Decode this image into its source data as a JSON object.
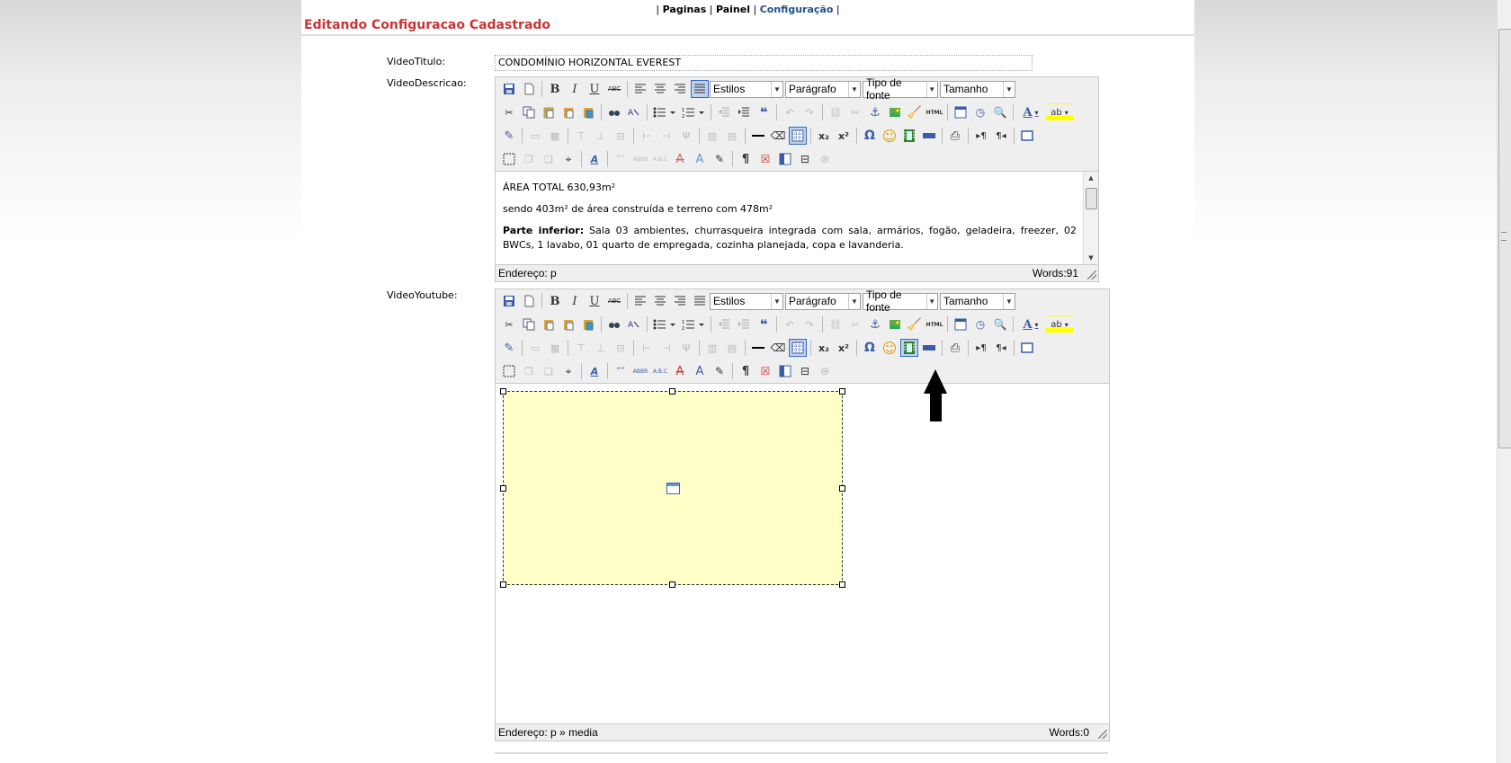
{
  "nav": {
    "pre": "| ",
    "links": [
      "Paginas",
      "Painel",
      "Configuração"
    ],
    "sep": " | ",
    "post": " |"
  },
  "page_title": "Editando Configuracao Cadastrado",
  "fields": {
    "titulo_label": "VideoTitulo:",
    "titulo_value": "CONDOMÍNIO HORIZONTAL EVEREST",
    "descricao_label": "VideoDescricao:",
    "youtube_label": "VideoYoutube:"
  },
  "toolbar": {
    "styles": "Estilos",
    "format": "Parágrafo",
    "font": "Tipo de fonte",
    "size": "Tamanho",
    "bold": "B",
    "italic": "I",
    "underline": "U",
    "strike": "ABC",
    "html": "HTML",
    "sub": "x₂",
    "sup": "x²",
    "omega": "Ω",
    "smile": "☺",
    "quote": "❝",
    "pilcrow": "¶"
  },
  "descricao": {
    "line1": "ÁREA TOTAL 630,93m²",
    "line2": "sendo 403m² de área construída e terreno com 478m²",
    "line3_bold": "Parte inferior:",
    "line3": " Sala 03 ambientes, churrasqueira integrada com sala, armários, fogão, geladeira, freezer, 02 BWCs, 1 lavabo, 01 quarto de empregada, cozinha planejada, copa e lavanderia.",
    "status_path_label": "Endereço: ",
    "status_path": "p",
    "words": "Words:91"
  },
  "youtube": {
    "status_path_label": "Endereço: ",
    "status_path": "p » media",
    "words": "Words:0"
  },
  "colors": {
    "title": "#cc3333",
    "active_link": "#1f4e8c",
    "media_bg": "#ffffc8"
  }
}
